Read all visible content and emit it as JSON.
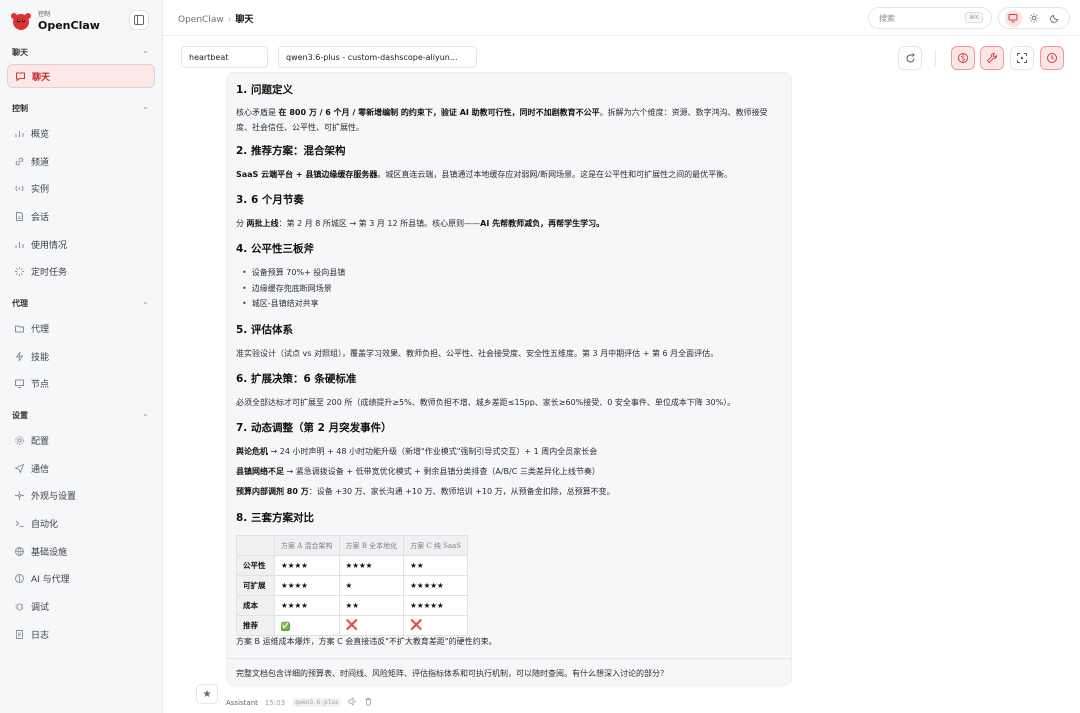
{
  "brand": {
    "subtitle": "控制",
    "name": "OpenClaw"
  },
  "sidebar": {
    "sections": [
      {
        "title": "聊天",
        "items": [
          {
            "label": "聊天",
            "icon": "chat-bubble-icon",
            "active": true
          }
        ]
      },
      {
        "title": "控制",
        "items": [
          {
            "label": "概览",
            "icon": "bar-chart-icon"
          },
          {
            "label": "频道",
            "icon": "link-icon"
          },
          {
            "label": "实例",
            "icon": "radio-icon"
          },
          {
            "label": "会话",
            "icon": "document-icon"
          },
          {
            "label": "使用情况",
            "icon": "bar-chart-icon"
          },
          {
            "label": "定时任务",
            "icon": "loader-icon"
          }
        ]
      },
      {
        "title": "代理",
        "items": [
          {
            "label": "代理",
            "icon": "folder-icon"
          },
          {
            "label": "技能",
            "icon": "bolt-icon"
          },
          {
            "label": "节点",
            "icon": "monitor-icon"
          }
        ]
      },
      {
        "title": "设置",
        "items": [
          {
            "label": "配置",
            "icon": "gear-icon"
          },
          {
            "label": "通信",
            "icon": "send-icon"
          },
          {
            "label": "外观与设置",
            "icon": "sparkle-icon"
          },
          {
            "label": "自动化",
            "icon": "terminal-icon"
          },
          {
            "label": "基础设施",
            "icon": "globe-icon"
          },
          {
            "label": "AI 与代理",
            "icon": "brain-icon"
          },
          {
            "label": "调试",
            "icon": "bug-icon"
          },
          {
            "label": "日志",
            "icon": "file-icon"
          }
        ]
      }
    ]
  },
  "topbar": {
    "breadcrumb_root": "OpenClaw",
    "breadcrumb_sep": "›",
    "breadcrumb_current": "聊天",
    "search_placeholder": "搜索",
    "search_shortcut": "⌘K"
  },
  "toolbar": {
    "session_value": "heartbeat",
    "model_value": "qwen3.6-plus - custom-dashscope-aliyun..."
  },
  "message": {
    "sections": [
      {
        "heading": "1. 问题定义"
      },
      {
        "heading": "2. 推荐方案：混合架构"
      },
      {
        "heading": "3. 6 个月节奏"
      },
      {
        "heading": "4. 公平性三板斧"
      },
      {
        "heading": "5. 评估体系"
      },
      {
        "heading": "6. 扩展决策：6 条硬标准"
      },
      {
        "heading": "7. 动态调整（第 2 月突发事件）"
      },
      {
        "heading": "8. 三套方案对比"
      }
    ],
    "p1_a": "核心矛盾是 ",
    "p1_b": "在 800 万 / 6 个月 / 零新增编制 的约束下，验证 AI 助教可行性，同时不加剧教育不公平",
    "p1_c": "。拆解为六个维度：资源、数字鸿沟、教师接受度、社会信任、公平性、可扩展性。",
    "p2_a": "SaaS 云端平台 + 县镇边缘缓存服务器",
    "p2_b": "。城区直连云端，县镇通过本地缓存应对弱网/断网场景。这是在公平性和可扩展性之间的最优平衡。",
    "p3_a": "分 ",
    "p3_b": "两批上线",
    "p3_c": "：第 2 月 8 所城区 → 第 3 月 12 所县镇。核心原则——",
    "p3_d": "AI 先帮教师减负，再帮学生学习。",
    "bullets": [
      "设备预算 70%+ 投向县镇",
      "边缘缓存兜底断网场景",
      "城区-县镇结对共享"
    ],
    "p5": "准实验设计（试点 vs 对照组），覆盖学习效果、教师负担、公平性、社会接受度、安全性五维度。第 3 月中期评估 + 第 6 月全面评估。",
    "p6": "必须全部达标才可扩展至 200 所（成绩提升≥5%、教师负担不增、城乡差距≤15pp、家长≥60%接受、0 安全事件、单位成本下降 30%）。",
    "p7_1a": "舆论危机",
    "p7_1b": " → 24 小时声明 + 48 小时功能升级（新增\"作业模式\"强制引导式交互）+ 1 周内全员家长会",
    "p7_2a": "县镇网络不足",
    "p7_2b": " → 紧急调拨设备 + 低带宽优化模式 + 剩余县镇分类排查（A/B/C 三类差异化上线节奏）",
    "p7_3a": "预算内部调剂 80 万",
    "p7_3b": "：设备 +30 万、家长沟通 +10 万、教师培训 +10 万，从预备金扣除，总预算不变。",
    "table": {
      "headers": [
        "",
        "方案 A 混合架构",
        "方案 B 全本地化",
        "方案 C 纯 SaaS"
      ],
      "rows": [
        {
          "label": "公平性",
          "cells": [
            "★★★★",
            "★★★★",
            "★★"
          ]
        },
        {
          "label": "可扩展",
          "cells": [
            "★★★★",
            "★",
            "★★★★★"
          ]
        },
        {
          "label": "成本",
          "cells": [
            "★★★★",
            "★★",
            "★★★★★"
          ]
        },
        {
          "label": "推荐",
          "cells": [
            "✅",
            "❌",
            "❌"
          ]
        }
      ]
    },
    "after_table": "方案 B 运维成本爆炸，方案 C 会直接违反\"不扩大教育差距\"的硬性约束。",
    "footer": "完整文档包含详细的预算表、时间线、风险矩阵、评估指标体系和可执行机制，可以随时查阅。有什么想深入讨论的部分？"
  },
  "meta": {
    "sender": "Assistant",
    "time": "15:03",
    "model": "qwen3.6-plus"
  },
  "colors": {
    "accent": "#d23b3b",
    "active_bg": "#fbe9e9",
    "check": "#4caf50",
    "cross": "#e53950"
  }
}
